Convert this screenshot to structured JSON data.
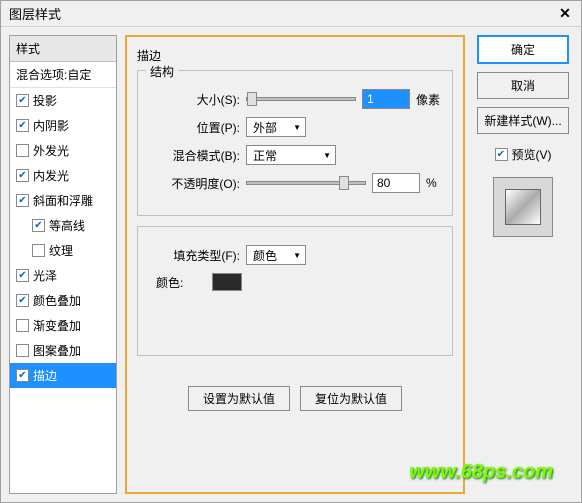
{
  "window": {
    "title": "图层样式",
    "close": "✕"
  },
  "left": {
    "header": "样式",
    "blend": "混合选项:自定",
    "items": [
      {
        "label": "投影",
        "checked": true,
        "indent": false
      },
      {
        "label": "内阴影",
        "checked": true,
        "indent": false
      },
      {
        "label": "外发光",
        "checked": false,
        "indent": false
      },
      {
        "label": "内发光",
        "checked": true,
        "indent": false
      },
      {
        "label": "斜面和浮雕",
        "checked": true,
        "indent": false
      },
      {
        "label": "等高线",
        "checked": true,
        "indent": true
      },
      {
        "label": "纹理",
        "checked": false,
        "indent": true
      },
      {
        "label": "光泽",
        "checked": true,
        "indent": false
      },
      {
        "label": "颜色叠加",
        "checked": true,
        "indent": false
      },
      {
        "label": "渐变叠加",
        "checked": false,
        "indent": false
      },
      {
        "label": "图案叠加",
        "checked": false,
        "indent": false
      },
      {
        "label": "描边",
        "checked": true,
        "indent": false,
        "selected": true
      }
    ]
  },
  "mid": {
    "title": "描边",
    "structure": {
      "legend": "结构",
      "size_label": "大小(S):",
      "size_value": "1",
      "size_unit": "像素",
      "position_label": "位置(P):",
      "position_value": "外部",
      "blend_label": "混合模式(B):",
      "blend_value": "正常",
      "opacity_label": "不透明度(O):",
      "opacity_value": "80",
      "opacity_unit": "%"
    },
    "fill": {
      "filltype_label": "填充类型(F):",
      "filltype_value": "颜色",
      "color_label": "颜色:",
      "color_value": "#2a2a2a"
    },
    "buttons": {
      "default": "设置为默认值",
      "reset": "复位为默认值"
    }
  },
  "right": {
    "ok": "确定",
    "cancel": "取消",
    "newstyle": "新建样式(W)...",
    "preview_label": "预览(V)",
    "preview_checked": true
  },
  "watermark": "www.68ps.com"
}
